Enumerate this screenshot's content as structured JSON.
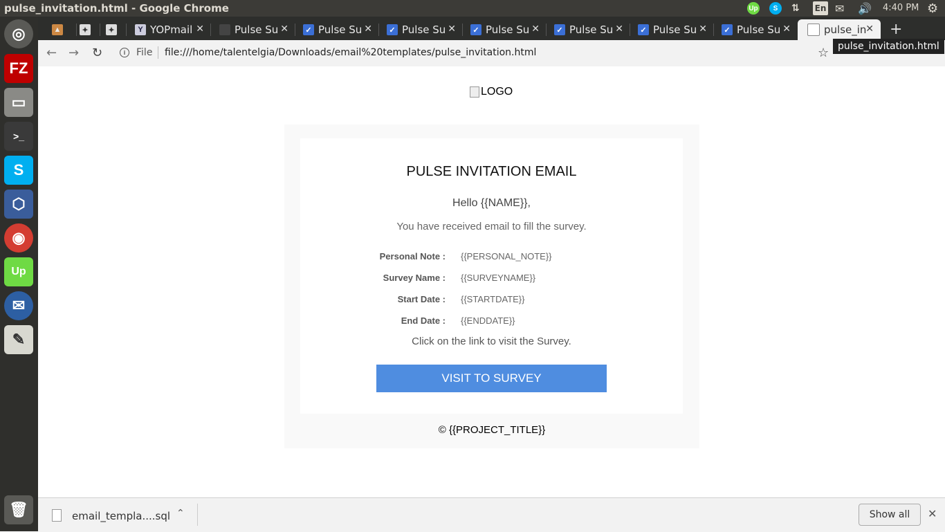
{
  "window": {
    "title": "pulse_invitation.html - Google Chrome"
  },
  "panel": {
    "clock": "4:40 PM",
    "keyboard": "En",
    "tray_icons": [
      "upwork-icon",
      "skype-icon",
      "network-icon",
      "keyboard-icon",
      "mail-icon",
      "volume-icon",
      "settings-gear-icon"
    ]
  },
  "launcher": {
    "items": [
      "ubuntu-dash-icon",
      "filezilla-icon",
      "files-icon",
      "terminal-icon",
      "skype-icon",
      "virtualbox-icon",
      "chrome-icon",
      "upwork-icon",
      "thunderbird-icon",
      "text-editor-icon",
      "trash-icon"
    ]
  },
  "tabs": [
    {
      "label": ""
    },
    {
      "label": ""
    },
    {
      "label": ""
    },
    {
      "label": "YOPmail"
    },
    {
      "label": "Pulse Su"
    },
    {
      "label": "Pulse Su"
    },
    {
      "label": "Pulse Su"
    },
    {
      "label": "Pulse Su"
    },
    {
      "label": "Pulse Su"
    },
    {
      "label": "Pulse Su"
    },
    {
      "label": "Pulse Su"
    },
    {
      "label": "pulse_in"
    }
  ],
  "toolbar": {
    "file_label": "File",
    "url": "file:///home/talentelgia/Downloads/email%20templates/pulse_invitation.html",
    "tooltip": "pulse_invitation.html"
  },
  "email": {
    "logo_alt": "LOGO",
    "heading": "PULSE INVITATION EMAIL",
    "greeting": "Hello {{NAME}},",
    "intro": "You have received email to fill the survey.",
    "rows": [
      {
        "label": "Personal Note :",
        "value": "{{PERSONAL_NOTE}}"
      },
      {
        "label": "Survey Name :",
        "value": "{{SURVEYNAME}}"
      },
      {
        "label": "Start Date :",
        "value": "{{STARTDATE}}"
      },
      {
        "label": "End Date :",
        "value": "{{ENDDATE}}"
      }
    ],
    "cta_text": "Click on the link to visit the Survey.",
    "button_label": "VISIT TO SURVEY",
    "footer": "© {{PROJECT_TITLE}}"
  },
  "download_bar": {
    "file_name": "email_templa....sql",
    "show_all": "Show all"
  }
}
